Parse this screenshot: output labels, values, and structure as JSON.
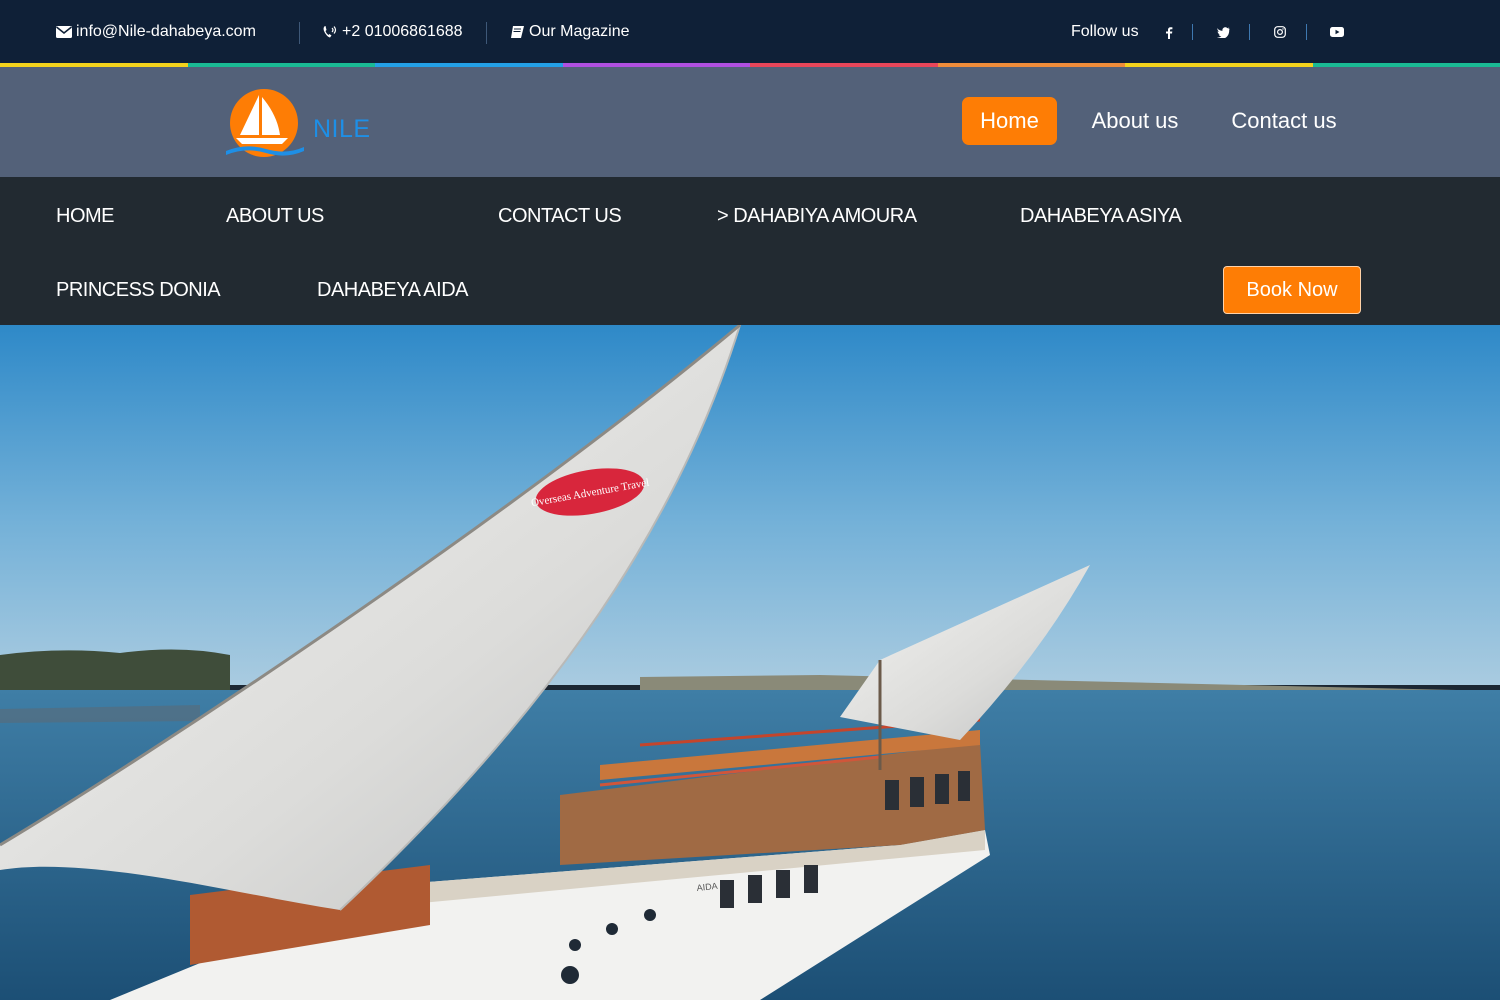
{
  "topbar": {
    "email": "info@Nile-dahabeya.com",
    "phone": "+2 01006861688",
    "magazine": "Our Magazine",
    "follow_label": "Follow us",
    "social": [
      {
        "icon": "facebook-icon"
      },
      {
        "icon": "twitter-icon"
      },
      {
        "icon": "instagram-icon"
      },
      {
        "icon": "youtube-icon"
      }
    ]
  },
  "rainbow_colors": [
    "#f3d21c",
    "#1aba94",
    "#24a0e6",
    "#b04fe0",
    "#e8465a",
    "#ef8c3a",
    "#f3d21c",
    "#1aba94"
  ],
  "header": {
    "logo_text": "NILE",
    "nav": [
      {
        "label": "Home",
        "active": true
      },
      {
        "label": "About us",
        "active": false
      },
      {
        "label": "Contact us",
        "active": false
      }
    ]
  },
  "menu": {
    "items": [
      {
        "label": "HOME"
      },
      {
        "label": "ABOUT US"
      },
      {
        "label": "CONTACT US"
      },
      {
        "label": "> DAHABIYA AMOURA"
      },
      {
        "label": "DAHABEYA ASIYA"
      },
      {
        "label": "PRINCESS DONIA"
      },
      {
        "label": "DAHABEYA AIDA"
      }
    ],
    "book_label": "Book Now"
  },
  "colors": {
    "topbar_bg": "#0f2037",
    "header_bg": "#536179",
    "menu_bg": "#222a31",
    "accent": "#fe7d05",
    "logo_blue": "#1e8fe6"
  },
  "hero": {
    "sail_badge": "Overseas Adventure Travel",
    "boat_name": "AIDA"
  }
}
